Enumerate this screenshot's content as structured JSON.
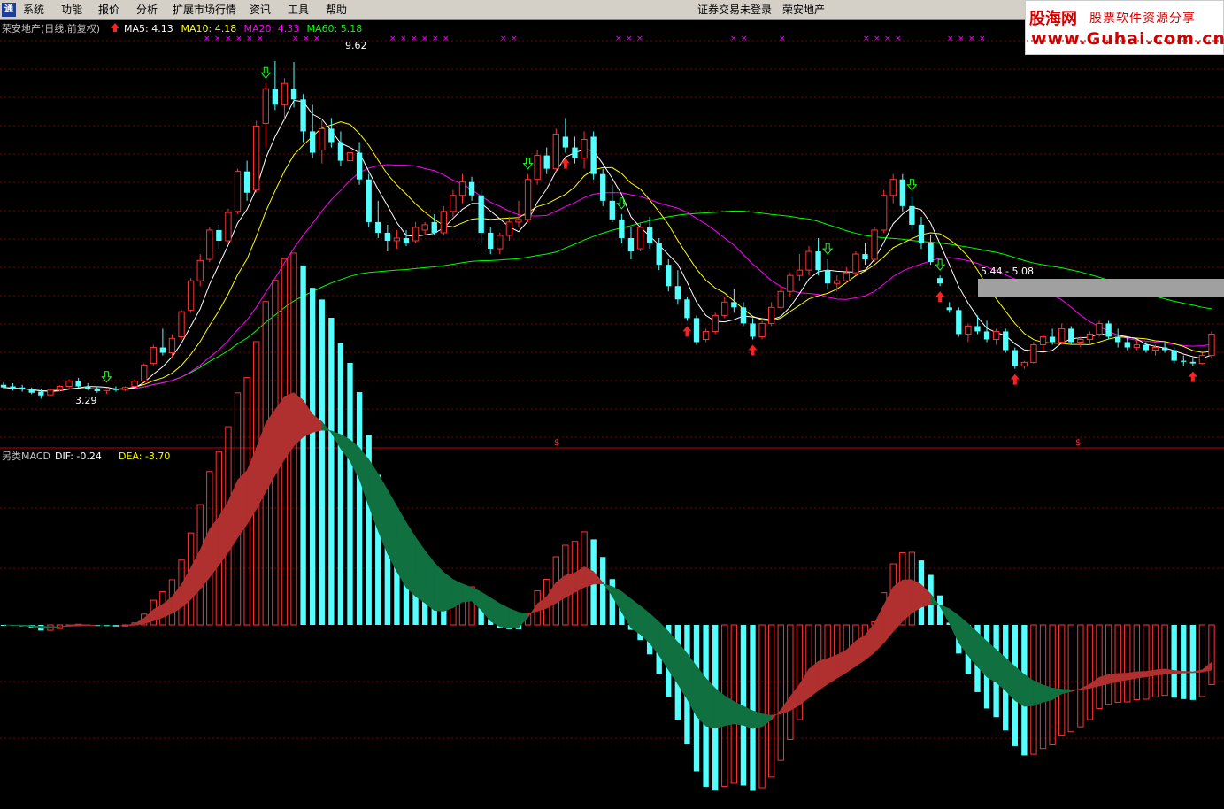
{
  "menu": {
    "items": [
      "系统",
      "功能",
      "报价",
      "分析",
      "扩展市场行情",
      "资讯",
      "工具",
      "帮助"
    ],
    "status": "证券交易未登录",
    "stock": "荣安地产"
  },
  "brand": {
    "name": "股海网",
    "slogan": "股票软件资源分享",
    "url": "www.Guhai.com.cn"
  },
  "main_panel": {
    "title": "荣安地产(日线,前复权)",
    "ma_labels": [
      {
        "text": "MA5: 4.13",
        "color": "#ffffff"
      },
      {
        "text": "MA10: 4.18",
        "color": "#ffff00"
      },
      {
        "text": "MA20: 4.33",
        "color": "#ff00ff"
      },
      {
        "text": "MA60: 5.18",
        "color": "#00ff00"
      }
    ],
    "high_label": "9.62",
    "low_label": "3.29",
    "range_label": "5.44 - 5.08",
    "dollar_mark": "$"
  },
  "macd_panel": {
    "title": "另类MACD",
    "dif_label": "DIF: -0.24",
    "dea_label": "DEA: -3.70"
  },
  "colors": {
    "up": "#ff3232",
    "down": "#54ffff",
    "ma5": "#ffffff",
    "ma10": "#ffff00",
    "ma20": "#ff00ff",
    "ma60": "#00ff00",
    "grid": "#800000",
    "ribbon_red": "#b03030",
    "ribbon_green": "#107040"
  },
  "chart_data": {
    "type": "candlestick",
    "y_range": [
      2.5,
      10.0
    ],
    "candles": [
      [
        3.55,
        3.6,
        3.47,
        3.5
      ],
      [
        3.52,
        3.58,
        3.44,
        3.47
      ],
      [
        3.5,
        3.55,
        3.42,
        3.46
      ],
      [
        3.47,
        3.5,
        3.37,
        3.4
      ],
      [
        3.42,
        3.48,
        3.29,
        3.35
      ],
      [
        3.36,
        3.47,
        3.34,
        3.45
      ],
      [
        3.45,
        3.54,
        3.43,
        3.52
      ],
      [
        3.52,
        3.65,
        3.48,
        3.62
      ],
      [
        3.62,
        3.68,
        3.5,
        3.52
      ],
      [
        3.52,
        3.58,
        3.45,
        3.48
      ],
      [
        3.48,
        3.52,
        3.4,
        3.43
      ],
      [
        3.44,
        3.5,
        3.38,
        3.47
      ],
      [
        3.47,
        3.52,
        3.42,
        3.45
      ],
      [
        3.46,
        3.52,
        3.43,
        3.5
      ],
      [
        3.52,
        3.65,
        3.5,
        3.62
      ],
      [
        3.62,
        3.95,
        3.6,
        3.92
      ],
      [
        3.95,
        4.3,
        3.9,
        4.25
      ],
      [
        4.25,
        4.6,
        4.1,
        4.15
      ],
      [
        4.15,
        4.5,
        4.05,
        4.42
      ],
      [
        4.45,
        4.95,
        4.4,
        4.92
      ],
      [
        4.95,
        5.55,
        4.9,
        5.5
      ],
      [
        5.5,
        6.0,
        5.4,
        5.88
      ],
      [
        5.9,
        6.5,
        5.85,
        6.45
      ],
      [
        6.45,
        6.55,
        6.1,
        6.25
      ],
      [
        6.25,
        6.85,
        6.2,
        6.78
      ],
      [
        6.8,
        7.6,
        6.75,
        7.55
      ],
      [
        7.55,
        7.75,
        7.0,
        7.15
      ],
      [
        7.2,
        8.5,
        7.15,
        8.4
      ],
      [
        8.45,
        9.2,
        8.0,
        9.1
      ],
      [
        9.1,
        9.62,
        8.7,
        8.8
      ],
      [
        8.8,
        9.3,
        8.5,
        9.2
      ],
      [
        9.1,
        9.6,
        8.75,
        8.9
      ],
      [
        8.9,
        9.0,
        8.1,
        8.3
      ],
      [
        8.3,
        8.8,
        7.8,
        7.9
      ],
      [
        7.95,
        8.5,
        7.7,
        8.35
      ],
      [
        8.35,
        8.55,
        8.0,
        8.1
      ],
      [
        8.1,
        8.3,
        7.65,
        7.75
      ],
      [
        7.75,
        8.0,
        7.5,
        7.9
      ],
      [
        7.9,
        8.1,
        7.3,
        7.4
      ],
      [
        7.4,
        7.5,
        6.5,
        6.6
      ],
      [
        6.6,
        7.0,
        6.3,
        6.4
      ],
      [
        6.4,
        6.55,
        6.05,
        6.25
      ],
      [
        6.25,
        6.45,
        6.1,
        6.3
      ],
      [
        6.3,
        6.45,
        6.15,
        6.2
      ],
      [
        6.25,
        6.6,
        6.2,
        6.5
      ],
      [
        6.45,
        6.6,
        6.35,
        6.55
      ],
      [
        6.6,
        6.75,
        6.35,
        6.4
      ],
      [
        6.4,
        6.9,
        6.35,
        6.8
      ],
      [
        6.8,
        7.2,
        6.7,
        7.1
      ],
      [
        7.1,
        7.5,
        6.95,
        7.35
      ],
      [
        7.35,
        7.45,
        7.0,
        7.1
      ],
      [
        7.1,
        7.2,
        6.2,
        6.4
      ],
      [
        6.4,
        6.5,
        6.0,
        6.1
      ],
      [
        6.1,
        6.4,
        6.0,
        6.35
      ],
      [
        6.35,
        6.7,
        6.25,
        6.6
      ],
      [
        6.6,
        7.0,
        6.5,
        6.65
      ],
      [
        6.65,
        7.5,
        6.6,
        7.4
      ],
      [
        7.4,
        7.95,
        7.3,
        7.85
      ],
      [
        7.85,
        8.0,
        7.5,
        7.6
      ],
      [
        7.6,
        8.35,
        7.55,
        8.25
      ],
      [
        8.2,
        8.55,
        7.9,
        8.0
      ],
      [
        8.0,
        8.2,
        7.7,
        7.8
      ],
      [
        7.8,
        8.3,
        7.6,
        8.15
      ],
      [
        8.2,
        8.3,
        7.4,
        7.5
      ],
      [
        7.5,
        7.6,
        6.9,
        7.0
      ],
      [
        7.0,
        7.3,
        6.6,
        6.65
      ],
      [
        6.65,
        6.75,
        6.2,
        6.3
      ],
      [
        6.3,
        6.5,
        5.9,
        6.05
      ],
      [
        6.1,
        6.6,
        6.05,
        6.5
      ],
      [
        6.5,
        6.7,
        6.1,
        6.2
      ],
      [
        6.2,
        6.3,
        5.7,
        5.8
      ],
      [
        5.8,
        5.9,
        5.3,
        5.4
      ],
      [
        5.4,
        5.7,
        5.05,
        5.15
      ],
      [
        5.15,
        5.2,
        4.75,
        4.8
      ],
      [
        4.8,
        4.85,
        4.3,
        4.35
      ],
      [
        4.4,
        4.6,
        4.35,
        4.55
      ],
      [
        4.55,
        4.9,
        4.5,
        4.85
      ],
      [
        4.85,
        5.2,
        4.8,
        5.1
      ],
      [
        5.1,
        5.35,
        4.9,
        5.0
      ],
      [
        5.0,
        5.1,
        4.65,
        4.7
      ],
      [
        4.7,
        4.8,
        4.4,
        4.45
      ],
      [
        4.45,
        4.75,
        4.4,
        4.7
      ],
      [
        4.7,
        5.1,
        4.65,
        5.0
      ],
      [
        5.0,
        5.4,
        4.95,
        5.3
      ],
      [
        5.3,
        5.65,
        5.2,
        5.6
      ],
      [
        5.6,
        6.0,
        5.5,
        5.7
      ],
      [
        5.7,
        6.15,
        5.6,
        6.05
      ],
      [
        6.05,
        6.3,
        5.6,
        5.7
      ],
      [
        5.7,
        5.9,
        5.35,
        5.45
      ],
      [
        5.45,
        5.6,
        5.3,
        5.5
      ],
      [
        5.5,
        5.75,
        5.45,
        5.65
      ],
      [
        5.65,
        6.05,
        5.6,
        6.0
      ],
      [
        6.0,
        6.2,
        5.8,
        5.9
      ],
      [
        5.9,
        6.5,
        5.85,
        6.45
      ],
      [
        6.45,
        7.2,
        6.4,
        7.1
      ],
      [
        7.1,
        7.5,
        6.95,
        7.4
      ],
      [
        7.4,
        7.5,
        6.8,
        6.9
      ],
      [
        6.9,
        7.1,
        6.45,
        6.55
      ],
      [
        6.55,
        6.7,
        6.1,
        6.2
      ],
      [
        6.2,
        6.35,
        5.8,
        5.85
      ],
      [
        5.55,
        5.6,
        5.4,
        5.45
      ],
      [
        5.0,
        5.1,
        4.9,
        4.95
      ],
      [
        4.95,
        5.0,
        4.45,
        4.5
      ],
      [
        4.5,
        4.7,
        4.35,
        4.65
      ],
      [
        4.65,
        4.85,
        4.5,
        4.55
      ],
      [
        4.55,
        4.75,
        4.35,
        4.4
      ],
      [
        4.4,
        4.6,
        4.3,
        4.55
      ],
      [
        4.55,
        4.6,
        4.15,
        4.2
      ],
      [
        4.2,
        4.25,
        3.85,
        3.9
      ],
      [
        3.9,
        4.0,
        3.85,
        3.97
      ],
      [
        3.97,
        4.35,
        3.95,
        4.3
      ],
      [
        4.3,
        4.5,
        4.2,
        4.45
      ],
      [
        4.45,
        4.6,
        4.3,
        4.35
      ],
      [
        4.35,
        4.7,
        4.3,
        4.6
      ],
      [
        4.6,
        4.65,
        4.3,
        4.35
      ],
      [
        4.35,
        4.45,
        4.25,
        4.4
      ],
      [
        4.4,
        4.55,
        4.3,
        4.5
      ],
      [
        4.5,
        4.75,
        4.45,
        4.7
      ],
      [
        4.7,
        4.75,
        4.4,
        4.45
      ],
      [
        4.45,
        4.6,
        4.25,
        4.35
      ],
      [
        4.35,
        4.45,
        4.2,
        4.25
      ],
      [
        4.25,
        4.4,
        4.2,
        4.3
      ],
      [
        4.3,
        4.35,
        4.15,
        4.2
      ],
      [
        4.2,
        4.3,
        4.1,
        4.25
      ],
      [
        4.25,
        4.35,
        4.15,
        4.2
      ],
      [
        4.2,
        4.25,
        3.95,
        4.0
      ],
      [
        4.0,
        4.1,
        3.9,
        3.98
      ],
      [
        3.98,
        4.05,
        3.9,
        3.95
      ],
      [
        3.95,
        4.15,
        3.93,
        4.1
      ],
      [
        4.1,
        4.55,
        4.05,
        4.5
      ]
    ],
    "buy_signal_indices": [
      60,
      73,
      80,
      100,
      108,
      127
    ],
    "sell_signal_indices": [
      11,
      28,
      56,
      66,
      88,
      97,
      100
    ]
  }
}
